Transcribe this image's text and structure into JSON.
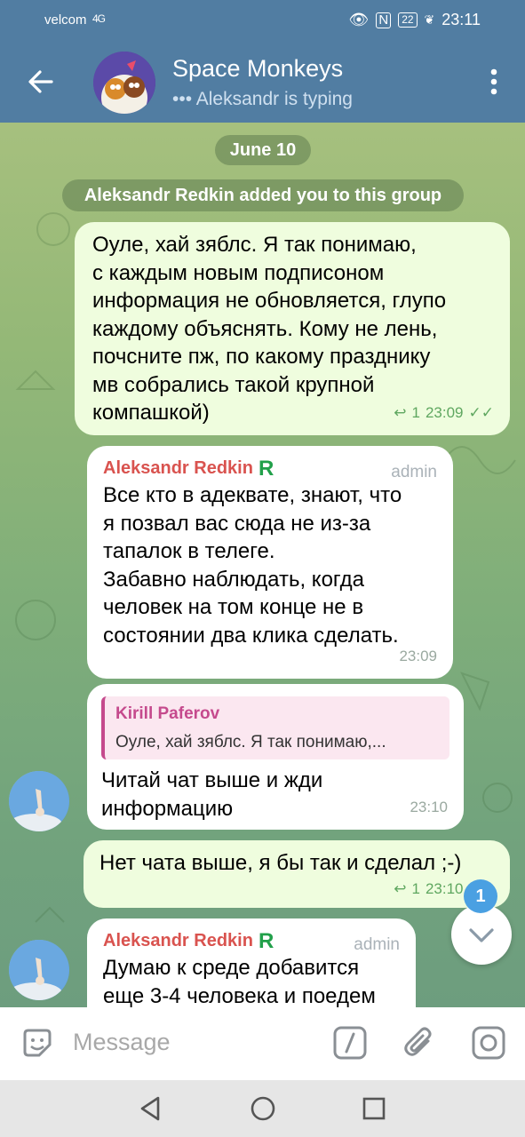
{
  "status": {
    "carrier": "velcom",
    "signal": "4G",
    "battery": "22",
    "time": "23:11"
  },
  "header": {
    "title": "Space Monkeys",
    "subtitle": "••• Aleksandr is typing"
  },
  "chat": {
    "date": "June 10",
    "system_message": "Aleksandr Redkin added you to this group",
    "messages": [
      {
        "text": "Оуле, хай зяблс. Я так понимаю,\nс каждым новым подписоном\nинформация не обновляется, глупо\nкаждому объяснять. Кому не лень,\nпочсните пж, по какому празднику\nмв собрались такой крупной\nкомпашкой)",
        "replies": "1",
        "time": "23:09"
      },
      {
        "sender": "Aleksandr Redkin",
        "badge": "R",
        "role": "admin",
        "text": "Все кто в адеквате, знают, что\nя позвал вас сюда не из-за\nтапалок в телеге.\nЗабавно наблюдать, когда\nчеловек на том конце не в\nсостоянии два клика сделать.",
        "time": "23:09"
      },
      {
        "reply_to_name": "Kirill Paferov",
        "reply_to_text": "Оуле, хай зяблс. Я так понимаю,...",
        "text": "Читай чат выше и жди\nинформацию",
        "time": "23:10"
      },
      {
        "text": "Нет чата выше, я бы так и сделал ;-)",
        "replies": "1",
        "time": "23:10"
      },
      {
        "sender": "Aleksandr Redkin",
        "badge": "R",
        "role": "admin",
        "text": "Думаю к среде добавится\nеще 3-4 человека и поедем"
      }
    ],
    "unread_count": "1"
  },
  "input": {
    "placeholder": "Message"
  },
  "colors": {
    "header": "#517da2",
    "outgoing_bubble": "#effdde",
    "incoming_bubble": "#ffffff",
    "sender_name": "#d9534f",
    "reply_accent": "#c54a8d",
    "read_check": "#5fa760"
  }
}
